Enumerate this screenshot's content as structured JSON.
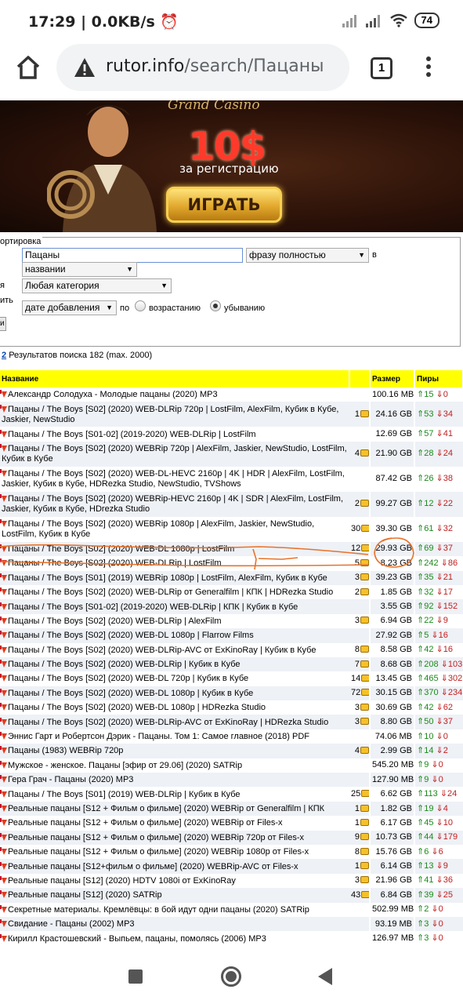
{
  "status": {
    "time": "17:29",
    "speed": "0.0KB/s",
    "battery": "74"
  },
  "browser": {
    "url_host": "rutor.info",
    "url_path": "/search/Пацаны",
    "tab_count": "1"
  },
  "banner": {
    "brand": "Grand Casino",
    "amount": "10$",
    "subtitle": "за регистрацию",
    "button": "ИГРАТЬ"
  },
  "search": {
    "legend": "ортировка",
    "query": "Пацаны",
    "match_mode": "фразу полностью",
    "in_label": "в",
    "scope": "названии",
    "row3_label": "я",
    "category": "Любая категория",
    "row4_label": "ить",
    "sort_by": "дате добавления",
    "by_label": "по",
    "asc_label": "возрастанию",
    "desc_label": "убыванию",
    "go_button": "и"
  },
  "results": {
    "page": "2",
    "summary": "Результатов поиска 182 (max. 2000)"
  },
  "table": {
    "headers": {
      "name": "Название",
      "size": "Размер",
      "peers": "Пиры"
    },
    "rows": [
      {
        "name": "Александр Солодуха - Молодые пацаны (2020) MP3",
        "comments": "",
        "size": "100.16 MB",
        "seeds": "15",
        "leech": "0"
      },
      {
        "name": "Пацаны / The Boys [S02] (2020) WEB-DLRip 720p | LostFilm, AlexFilm, Кубик в Кубе, Jaskier, NewStudio",
        "comments": "1",
        "size": "24.16 GB",
        "seeds": "53",
        "leech": "34"
      },
      {
        "name": "Пацаны / The Boys [S01-02] (2019-2020) WEB-DLRip | LostFilm",
        "comments": "",
        "size": "12.69 GB",
        "seeds": "57",
        "leech": "41"
      },
      {
        "name": "Пацаны / The Boys [S02] (2020) WEBRip 720p | AlexFilm, Jaskier, NewStudio, LostFilm, Кубик в Кубе",
        "comments": "4",
        "size": "21.90 GB",
        "seeds": "28",
        "leech": "24"
      },
      {
        "name": "Пацаны / The Boys [S02] (2020) WEB-DL-HEVC 2160p | 4K | HDR | AlexFilm, LostFilm, Jaskier, Кубик в Кубе, HDRezka Studio, NewStudio, TVShows",
        "comments": "",
        "size": "87.42 GB",
        "seeds": "26",
        "leech": "38"
      },
      {
        "name": "Пацаны / The Boys [S02] (2020) WEBRip-HEVC 2160p | 4K | SDR | AlexFilm, LostFilm, Jaskier, Кубик в Кубе, HDrezka Studio",
        "comments": "2",
        "size": "99.27 GB",
        "seeds": "12",
        "leech": "22"
      },
      {
        "name": "Пацаны / The Boys [S02] (2020) WEBRip 1080p | AlexFilm, Jaskier, NewStudio, LostFilm, Кубик в Кубе",
        "comments": "30",
        "size": "39.30 GB",
        "seeds": "61",
        "leech": "32"
      },
      {
        "name": "Пацаны / The Boys [S02] (2020) WEB-DL 1080p | LostFilm",
        "comments": "12",
        "size": "29.93 GB",
        "seeds": "69",
        "leech": "37"
      },
      {
        "name": "Пацаны / The Boys [S02] (2020) WEB-DLRip | LostFilm",
        "comments": "5",
        "size": "8.23 GB",
        "seeds": "242",
        "leech": "86"
      },
      {
        "name": "Пацаны / The Boys [S01] (2019) WEBRip 1080p | LostFilm, AlexFilm, Кубик в Кубе",
        "comments": "3",
        "size": "39.23 GB",
        "seeds": "35",
        "leech": "21"
      },
      {
        "name": "Пацаны / The Boys [S02] (2020) WEB-DLRip от Generalfilm | КПК | HDRezka Studio",
        "comments": "2",
        "size": "1.85 GB",
        "seeds": "32",
        "leech": "17"
      },
      {
        "name": "Пацаны / The Boys [S01-02] (2019-2020) WEB-DLRip | КПК | Кубик в Кубе",
        "comments": "",
        "size": "3.55 GB",
        "seeds": "92",
        "leech": "152"
      },
      {
        "name": "Пацаны / The Boys [S02] (2020) WEB-DLRip | AlexFilm",
        "comments": "3",
        "size": "6.94 GB",
        "seeds": "22",
        "leech": "9"
      },
      {
        "name": "Пацаны / The Boys [S02] (2020) WEB-DL 1080p | Flarrow Films",
        "comments": "",
        "size": "27.92 GB",
        "seeds": "5",
        "leech": "16"
      },
      {
        "name": "Пацаны / The Boys [S02] (2020) WEB-DLRip-AVC от ExKinoRay | Кубик в Кубе",
        "comments": "8",
        "size": "8.58 GB",
        "seeds": "42",
        "leech": "16"
      },
      {
        "name": "Пацаны / The Boys [S02] (2020) WEB-DLRip | Кубик в Кубе",
        "comments": "7",
        "size": "8.68 GB",
        "seeds": "208",
        "leech": "103"
      },
      {
        "name": "Пацаны / The Boys [S02] (2020) WEB-DL 720p | Кубик в Кубе",
        "comments": "14",
        "size": "13.45 GB",
        "seeds": "465",
        "leech": "302"
      },
      {
        "name": "Пацаны / The Boys [S02] (2020) WEB-DL 1080p | Кубик в Кубе",
        "comments": "72",
        "size": "30.15 GB",
        "seeds": "370",
        "leech": "234"
      },
      {
        "name": "Пацаны / The Boys [S02] (2020) WEB-DL 1080p | HDRezka Studio",
        "comments": "3",
        "size": "30.69 GB",
        "seeds": "42",
        "leech": "62"
      },
      {
        "name": "Пацаны / The Boys [S02] (2020) WEB-DLRip-AVC от ExKinoRay | HDRezka Studio",
        "comments": "3",
        "size": "8.80 GB",
        "seeds": "50",
        "leech": "37"
      },
      {
        "name": "Эннис Гарт и Робертсон Дэрик - Пацаны. Том 1: Самое главное (2018) PDF",
        "comments": "",
        "size": "74.06 MB",
        "seeds": "10",
        "leech": "0"
      },
      {
        "name": "Пацаны (1983) WEBRip 720p",
        "comments": "4",
        "size": "2.99 GB",
        "seeds": "14",
        "leech": "2"
      },
      {
        "name": "Мужское - женское. Пацаны [эфир от 29.06] (2020) SATRip",
        "comments": "",
        "size": "545.20 MB",
        "seeds": "9",
        "leech": "0"
      },
      {
        "name": "Гера Грач - Пацаны (2020) MP3",
        "comments": "",
        "size": "127.90 MB",
        "seeds": "9",
        "leech": "0"
      },
      {
        "name": "Пацаны / The Boys [S01] (2019) WEB-DLRip | Кубик в Кубе",
        "comments": "25",
        "size": "6.62 GB",
        "seeds": "113",
        "leech": "24"
      },
      {
        "name": "Реальные пацаны [S12 + Фильм о фильме] (2020) WEBRip от Generalfilm | КПК",
        "comments": "1",
        "size": "1.82 GB",
        "seeds": "19",
        "leech": "4"
      },
      {
        "name": "Реальные пацаны [S12 + Фильм о фильме] (2020) WEBRip от Files-x",
        "comments": "1",
        "size": "6.17 GB",
        "seeds": "45",
        "leech": "10"
      },
      {
        "name": "Реальные пацаны [S12 + Фильм о фильме] (2020) WEBRip 720p от Files-x",
        "comments": "9",
        "size": "10.73 GB",
        "seeds": "44",
        "leech": "179"
      },
      {
        "name": "Реальные пацаны [S12 + Фильм о фильме] (2020) WEBRip 1080p от Files-x",
        "comments": "8",
        "size": "15.76 GB",
        "seeds": "6",
        "leech": "6"
      },
      {
        "name": "Реальные пацаны [S12+фильм о фильме] (2020) WEBRip-AVC от Files-x",
        "comments": "1",
        "size": "6.14 GB",
        "seeds": "13",
        "leech": "9"
      },
      {
        "name": "Реальные пацаны [S12] (2020) HDTV 1080i от ExKinoRay",
        "comments": "3",
        "size": "21.96 GB",
        "seeds": "41",
        "leech": "36"
      },
      {
        "name": "Реальные пацаны [S12] (2020) SATRip",
        "comments": "43",
        "size": "6.84 GB",
        "seeds": "39",
        "leech": "25"
      },
      {
        "name": "Секретные материалы. Кремлёвцы: в бой идут одни пацаны (2020) SATRip",
        "comments": "",
        "size": "502.99 MB",
        "seeds": "2",
        "leech": "0"
      },
      {
        "name": "Свидание - Пацаны (2002) MP3",
        "comments": "",
        "size": "93.19 MB",
        "seeds": "3",
        "leech": "0"
      },
      {
        "name": "Кирилл Крастошевский - Выпьем, пацаны, помолясь (2006) MP3",
        "comments": "",
        "size": "126.97 MB",
        "seeds": "3",
        "leech": "0"
      }
    ]
  },
  "colors": {
    "header_yellow": "#ffff00",
    "annotation_orange": "#e8722a",
    "seed_green": "#1a8a1a",
    "leech_red": "#c02020"
  }
}
